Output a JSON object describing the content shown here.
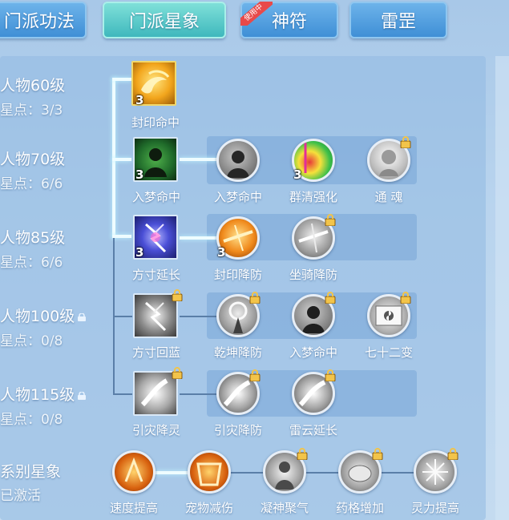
{
  "tabs": [
    {
      "label": "门派功法"
    },
    {
      "label": "门派星象"
    },
    {
      "label": "神符",
      "badge": "使用中"
    },
    {
      "label": "雷罡"
    }
  ],
  "rows": [
    {
      "level": "人物60级",
      "points": "星点：3/3",
      "locked": false
    },
    {
      "level": "人物70级",
      "points": "星点：6/6",
      "locked": false
    },
    {
      "level": "人物85级",
      "points": "星点：6/6",
      "locked": false
    },
    {
      "level": "人物100级",
      "points": "星点：0/8",
      "locked": true
    },
    {
      "level": "人物115级",
      "points": "星点：0/8",
      "locked": true
    }
  ],
  "series": {
    "title": "系别星象",
    "status": "已激活"
  },
  "nodes": {
    "r1": [
      {
        "name": "封印命中",
        "count": "3",
        "locked": false,
        "icon": "seal-hit-icon"
      }
    ],
    "r2": [
      {
        "name": "入梦命中",
        "count": "3",
        "locked": false,
        "icon": "dream-figure-icon"
      },
      {
        "name": "入梦命中",
        "count": "",
        "locked": false,
        "icon": "dream-head-icon"
      },
      {
        "name": "群清强化",
        "count": "3",
        "locked": false,
        "icon": "rainbow-target-icon"
      },
      {
        "name": "通 魂",
        "count": "",
        "locked": true,
        "icon": "soul-icon"
      }
    ],
    "r3": [
      {
        "name": "方寸延长",
        "count": "3",
        "locked": false,
        "icon": "lightning-rune-icon"
      },
      {
        "name": "封印降防",
        "count": "3",
        "locked": false,
        "icon": "seal-defense-icon"
      },
      {
        "name": "坐骑降防",
        "count": "",
        "locked": true,
        "icon": "mount-defense-icon"
      }
    ],
    "r4": [
      {
        "name": "方寸回蓝",
        "count": "",
        "locked": true,
        "icon": "mana-rune-icon"
      },
      {
        "name": "乾坤降防",
        "count": "",
        "locked": true,
        "icon": "qiankun-icon"
      },
      {
        "name": "入梦命中",
        "count": "",
        "locked": true,
        "icon": "dream-head-icon"
      },
      {
        "name": "七十二变",
        "count": "",
        "locked": true,
        "icon": "scroll-icon"
      }
    ],
    "r5": [
      {
        "name": "引灾降灵",
        "count": "",
        "locked": true,
        "icon": "disaster-icon"
      },
      {
        "name": "引灾降防",
        "count": "",
        "locked": true,
        "icon": "disaster-defense-icon"
      },
      {
        "name": "雷云延长",
        "count": "",
        "locked": true,
        "icon": "thunder-cloud-icon"
      }
    ],
    "bottom": [
      {
        "name": "速度提高",
        "locked": false,
        "icon": "speed-icon"
      },
      {
        "name": "宠物减伤",
        "locked": false,
        "icon": "pet-shield-icon"
      },
      {
        "name": "凝神聚气",
        "locked": true,
        "icon": "focus-icon"
      },
      {
        "name": "药格增加",
        "locked": true,
        "icon": "potion-icon"
      },
      {
        "name": "灵力提高",
        "locked": true,
        "icon": "spirit-icon"
      }
    ]
  },
  "colors": {
    "tab": "#4a9ae0",
    "tab_active": "#4cc3c4",
    "line_active": "#eefcff",
    "line_inactive": "#5a7ea8",
    "lock": "#f2c44a"
  }
}
